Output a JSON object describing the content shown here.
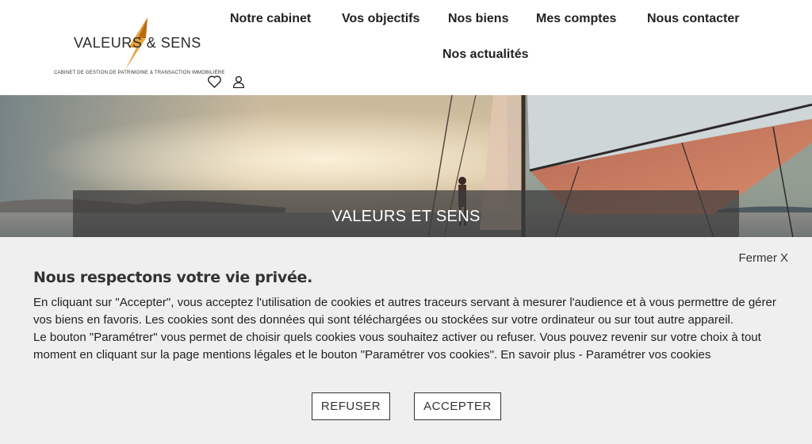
{
  "brand": {
    "name": "VALEURS & SENS",
    "tagline": "CABINET DE GESTION DE PATRIMOINE & TRANSACTION IMMOBILIÈRE",
    "accent_color": "#e8a33a"
  },
  "nav": {
    "items": [
      {
        "label": "Notre cabinet"
      },
      {
        "label": "Vos objectifs"
      },
      {
        "label": "Nos biens"
      },
      {
        "label": "Mes comptes"
      },
      {
        "label": "Nous contacter"
      },
      {
        "label": "Nos actualités"
      }
    ],
    "icons": [
      "heart-icon",
      "user-icon"
    ]
  },
  "hero": {
    "title": "VALEURS ET SENS"
  },
  "cookie": {
    "close_label": "Fermer X",
    "title": "Nous respectons votre vie privée.",
    "paragraph1": "En cliquant sur \"Accepter\", vous acceptez l'utilisation de cookies et autres traceurs servant à mesurer l'audience et à vous permettre de gérer vos biens en favoris. Les cookies sont des données qui sont téléchargées ou stockées sur votre ordinateur ou sur tout autre appareil.",
    "paragraph2": "Le bouton \"Paramétrer\" vous permet de choisir quels cookies vous souhaitez activer ou refuser. Vous pouvez revenir sur votre choix à tout moment en cliquant sur la page mentions légales et le bouton \"Paramétrer vos cookies\". En savoir plus - Paramétrer vos cookies",
    "refuse_label": "REFUSER",
    "accept_label": "ACCEPTER"
  }
}
